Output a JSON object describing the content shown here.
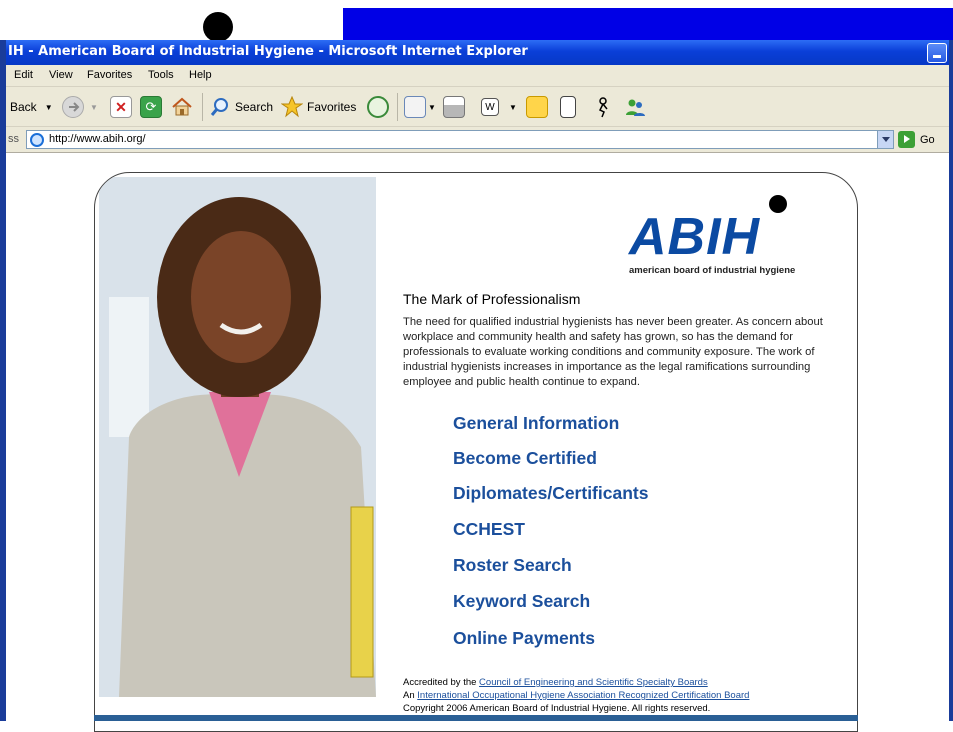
{
  "window": {
    "title": "IH - American Board of Industrial Hygiene - Microsoft Internet Explorer"
  },
  "menu": [
    "Edit",
    "View",
    "Favorites",
    "Tools",
    "Help"
  ],
  "toolbar": {
    "back_label": "Back",
    "search_label": "Search",
    "favorites_label": "Favorites"
  },
  "address": {
    "label": "ss",
    "url": "http://www.abih.org/",
    "go_label": "Go"
  },
  "page": {
    "logo_text": "ABIH",
    "logo_tagline": "american board of industrial hygiene",
    "heading": "The Mark of Professionalism",
    "intro": "The need for qualified industrial hygienists has never been greater. As concern about workplace and community health and safety has grown, so has the demand for professionals to evaluate working conditions and community exposure. The work of industrial hygienists increases in importance as the legal ramifications surrounding employee and public health continue to expand.",
    "nav": [
      "General Information",
      "Become Certified",
      "Diplomates/Certificants",
      "CCHEST",
      "Roster Search",
      "Keyword Search",
      "Online Payments"
    ],
    "footer": {
      "accredited_prefix": "Accredited by the",
      "accredited_link": "Council of Engineering and Scientific Specialty Boards",
      "ioha_prefix": "An",
      "ioha_link": "International Occupational Hygiene Association Recognized Certification Board",
      "copyright": "Copyright 2006 American Board of Industrial Hygiene. All rights reserved."
    }
  },
  "colors": {
    "titlebar": "#0a3fd8",
    "nav_link": "#1b4f9c",
    "logo": "#0b4aa2"
  }
}
